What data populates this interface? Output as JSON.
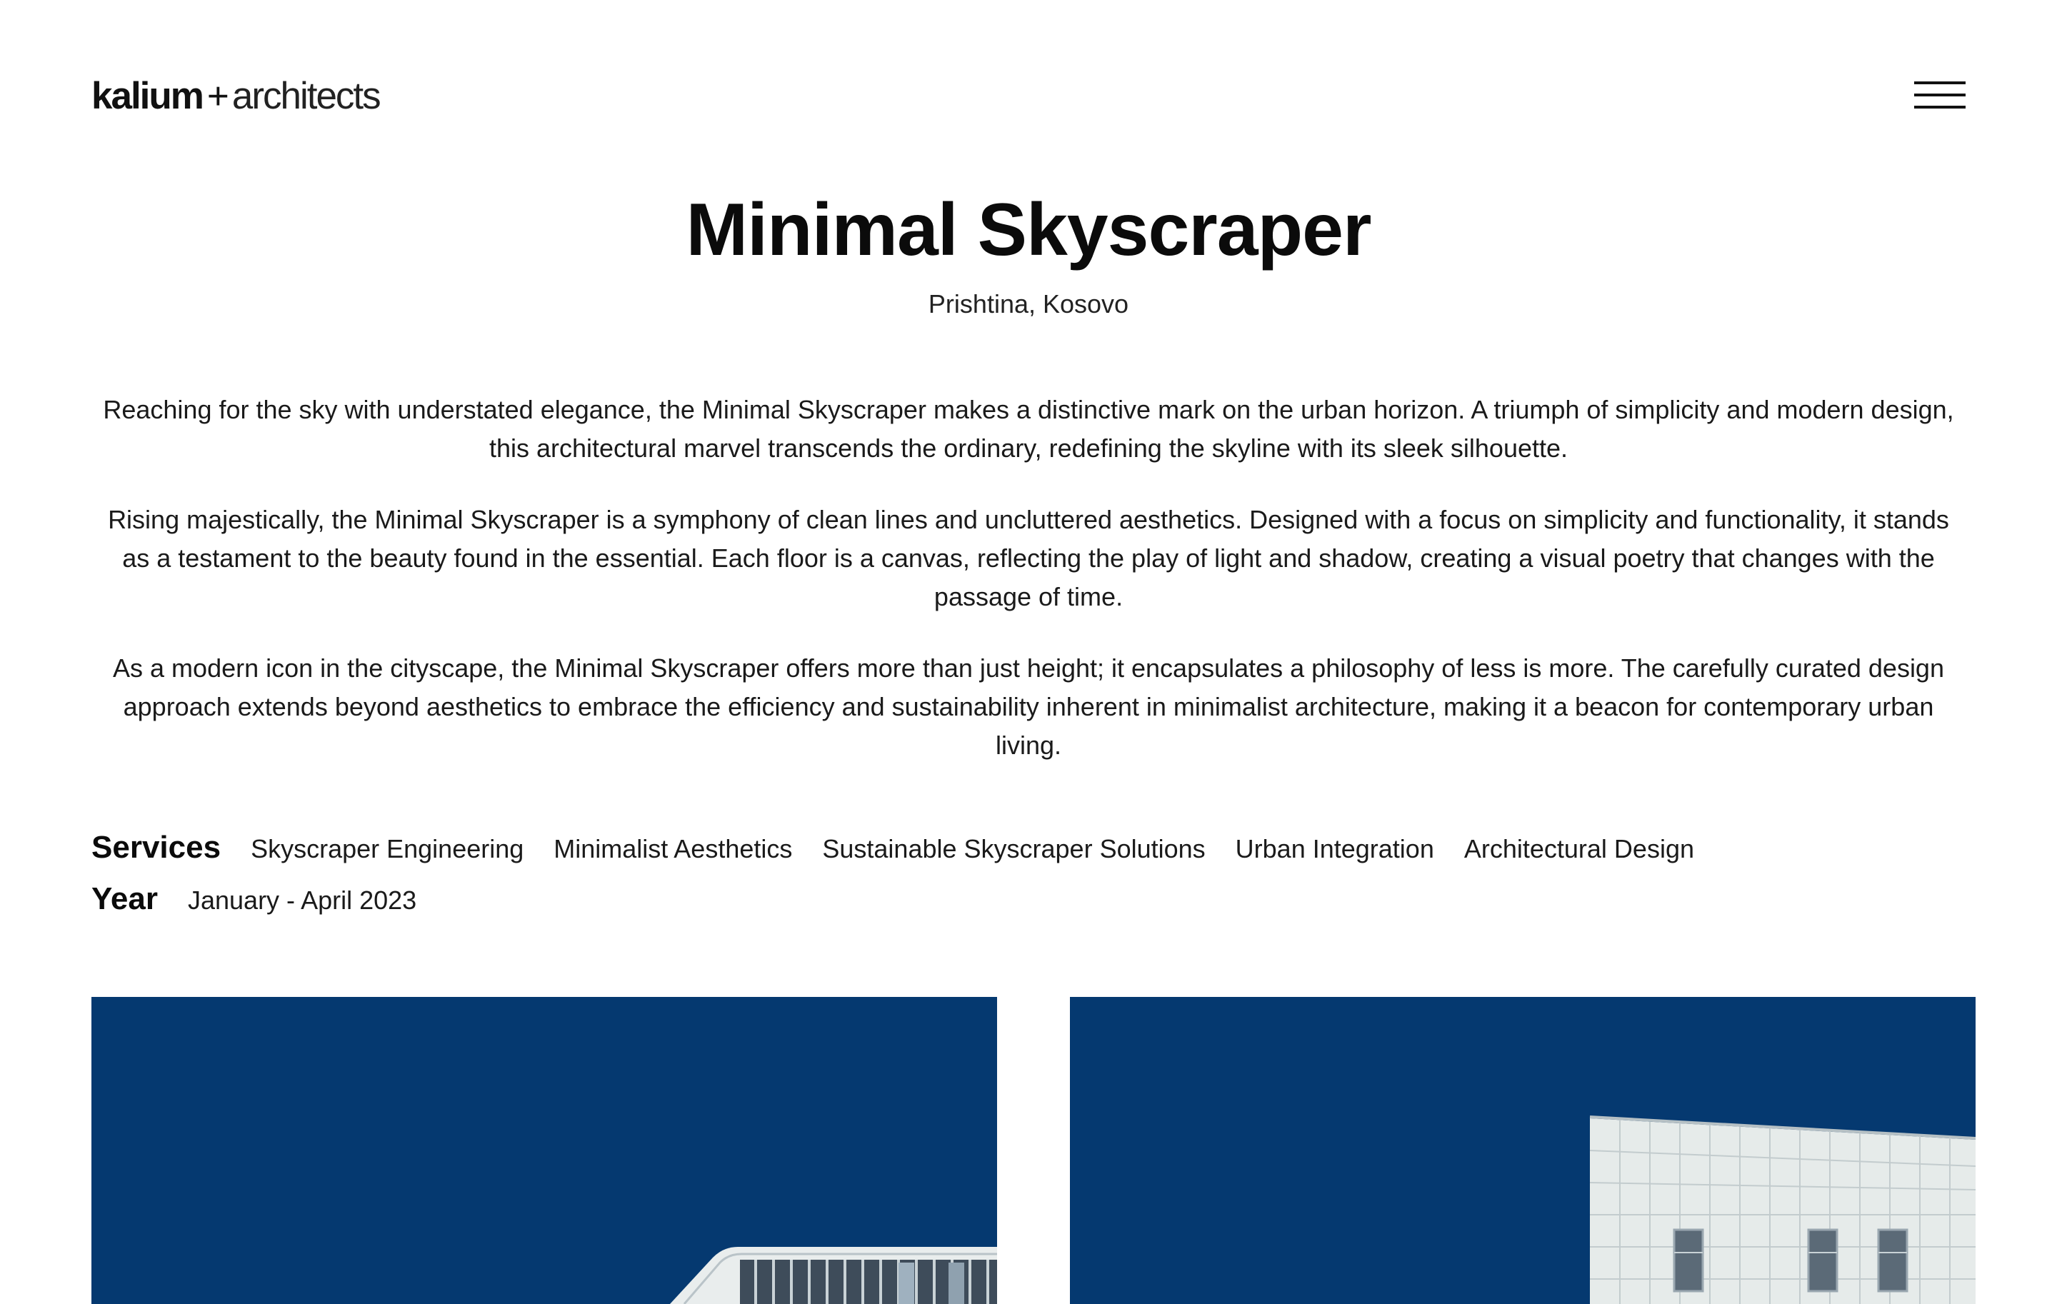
{
  "header": {
    "logo_brand": "kalium",
    "logo_sep": "+",
    "logo_tail": "architects",
    "menu_icon": "hamburger-menu-icon"
  },
  "project": {
    "title": "Minimal Skyscraper",
    "location": "Prishtina, Kosovo",
    "paragraphs": [
      "Reaching for the sky with understated elegance, the Minimal Skyscraper makes a distinctive mark on the urban horizon. A triumph of simplicity and modern design, this architectural marvel transcends the ordinary, redefining the skyline with its sleek silhouette.",
      "Rising majestically, the Minimal Skyscraper is a symphony of clean lines and uncluttered aesthetics. Designed with a focus on simplicity and functionality, it stands as a testament to the beauty found in the essential. Each floor is a canvas, reflecting the play of light and shadow, creating a visual poetry that changes with the passage of time.",
      "As a modern icon in the cityscape, the Minimal Skyscraper offers more than just height; it encapsulates a philosophy of less is more. The carefully curated design approach extends beyond aesthetics to embrace the efficiency and sustainability inherent in minimalist architecture, making it a beacon for contemporary urban living."
    ]
  },
  "meta": {
    "services_label": "Services",
    "services": [
      "Skyscraper Engineering",
      "Minimalist Aesthetics",
      "Sustainable Skyscraper Solutions",
      "Urban Integration",
      "Architectural Design"
    ],
    "year_label": "Year",
    "year_value": "January - April 2023"
  },
  "gallery": {
    "sky_color": "#053970",
    "building_color": "#e8ecec",
    "window_color": "#4a5a68"
  }
}
